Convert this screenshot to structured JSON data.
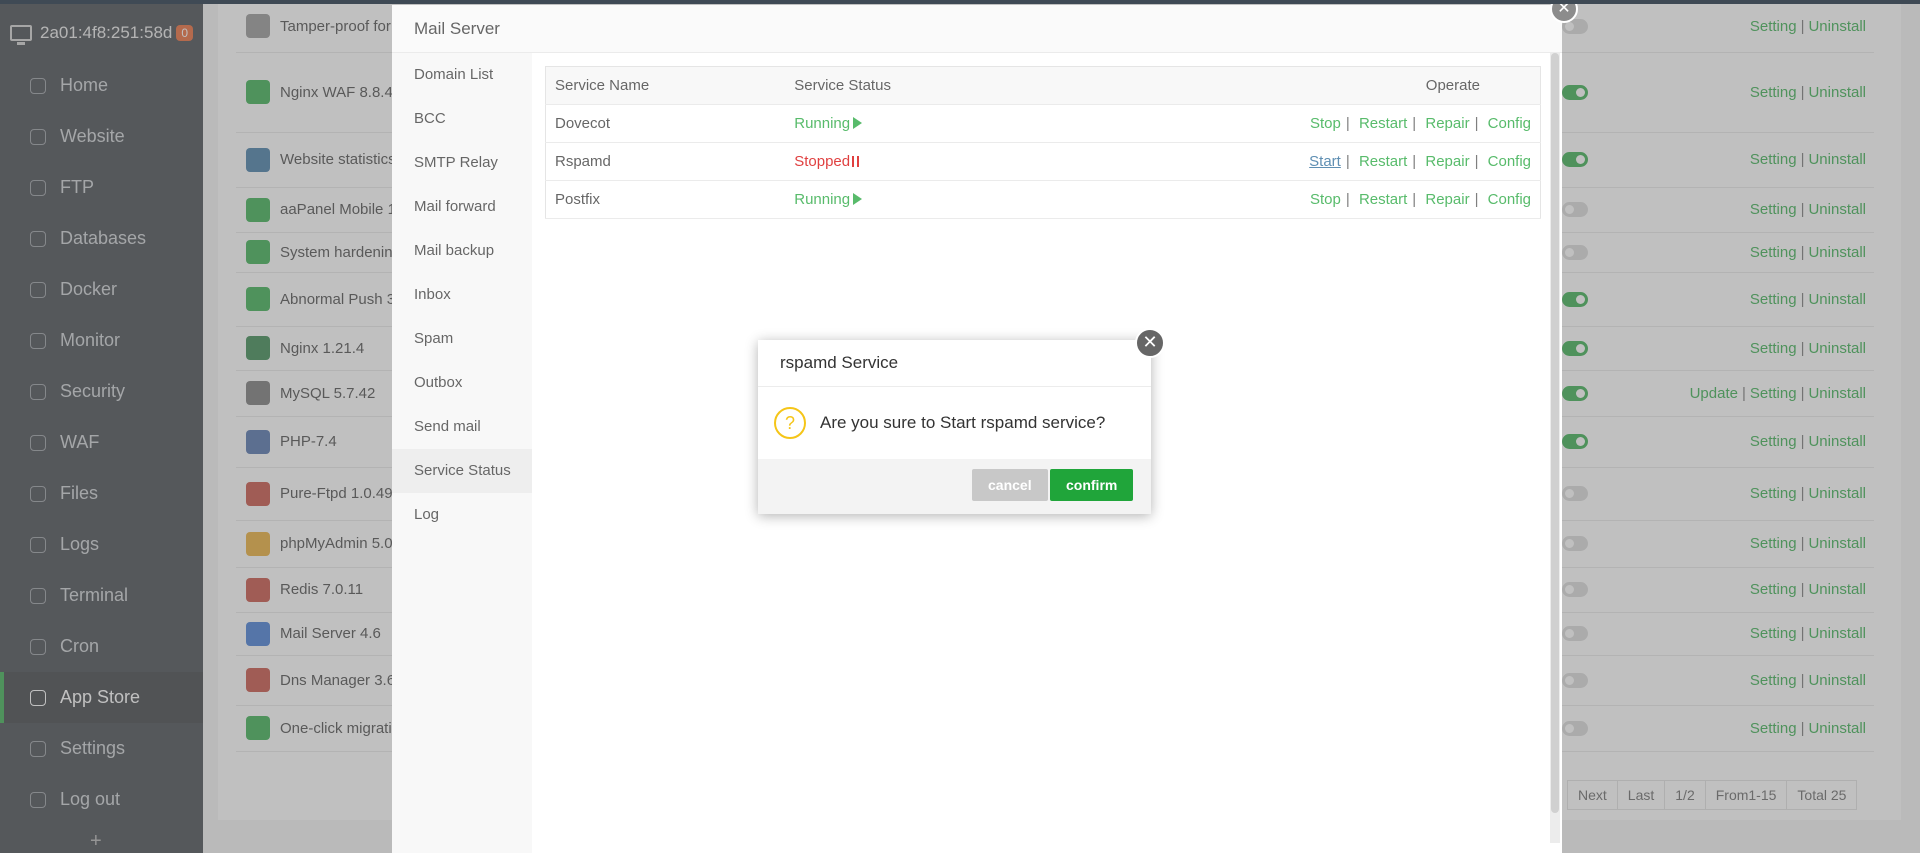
{
  "server": {
    "ip": "2a01:4f8:251:58d",
    "badge": "0"
  },
  "sidebar": {
    "items": [
      {
        "label": "Home"
      },
      {
        "label": "Website"
      },
      {
        "label": "FTP"
      },
      {
        "label": "Databases"
      },
      {
        "label": "Docker"
      },
      {
        "label": "Monitor"
      },
      {
        "label": "Security"
      },
      {
        "label": "WAF"
      },
      {
        "label": "Files"
      },
      {
        "label": "Logs"
      },
      {
        "label": "Terminal"
      },
      {
        "label": "Cron"
      },
      {
        "label": "App Store"
      },
      {
        "label": "Settings"
      },
      {
        "label": "Log out"
      }
    ],
    "add_label": "+"
  },
  "apps": [
    {
      "name": "Tamper-proof for",
      "on": false,
      "ops": [
        "Setting",
        "Uninstall"
      ]
    },
    {
      "name": "Nginx WAF 8.8.4",
      "on": true,
      "ops": [
        "Setting",
        "Uninstall"
      ]
    },
    {
      "name": "Website statistics",
      "on": true,
      "ops": [
        "Setting",
        "Uninstall"
      ]
    },
    {
      "name": "aaPanel Mobile 1",
      "on": false,
      "ops": [
        "Setting",
        "Uninstall"
      ]
    },
    {
      "name": "System hardening",
      "on": false,
      "ops": [
        "Setting",
        "Uninstall"
      ]
    },
    {
      "name": "Abnormal Push 3",
      "on": true,
      "ops": [
        "Setting",
        "Uninstall"
      ]
    },
    {
      "name": "Nginx 1.21.4",
      "on": true,
      "ops": [
        "Setting",
        "Uninstall"
      ]
    },
    {
      "name": "MySQL 5.7.42",
      "on": true,
      "ops": [
        "Update",
        "Setting",
        "Uninstall"
      ]
    },
    {
      "name": "PHP-7.4",
      "on": true,
      "ops": [
        "Setting",
        "Uninstall"
      ]
    },
    {
      "name": "Pure-Ftpd 1.0.49",
      "on": false,
      "ops": [
        "Setting",
        "Uninstall"
      ]
    },
    {
      "name": "phpMyAdmin 5.0",
      "on": false,
      "ops": [
        "Setting",
        "Uninstall"
      ]
    },
    {
      "name": "Redis 7.0.11",
      "on": false,
      "ops": [
        "Setting",
        "Uninstall"
      ]
    },
    {
      "name": "Mail Server 4.6",
      "on": false,
      "ops": [
        "Setting",
        "Uninstall"
      ]
    },
    {
      "name": "Dns Manager 3.6",
      "on": false,
      "ops": [
        "Setting",
        "Uninstall"
      ]
    },
    {
      "name": "One-click migrati",
      "on": false,
      "ops": [
        "Setting",
        "Uninstall"
      ]
    }
  ],
  "pager": {
    "next": "Next",
    "last": "Last",
    "page": "1/2",
    "range": "From1-15",
    "total": "Total 25"
  },
  "mail": {
    "title": "Mail Server",
    "menu": [
      "Domain List",
      "BCC",
      "SMTP Relay",
      "Mail forward",
      "Mail backup",
      "Inbox",
      "Spam",
      "Outbox",
      "Send mail",
      "Service Status",
      "Log"
    ],
    "selected_menu": "Service Status",
    "table": {
      "headers": {
        "name": "Service Name",
        "status": "Service Status",
        "operate": "Operate"
      },
      "rows": [
        {
          "name": "Dovecot",
          "status": "Running",
          "ops": [
            "Stop",
            "Restart",
            "Repair",
            "Config"
          ]
        },
        {
          "name": "Rspamd",
          "status": "Stopped",
          "ops": [
            "Start",
            "Restart",
            "Repair",
            "Config"
          ]
        },
        {
          "name": "Postfix",
          "status": "Running",
          "ops": [
            "Stop",
            "Restart",
            "Repair",
            "Config"
          ]
        }
      ]
    }
  },
  "dialog": {
    "title": "rspamd Service",
    "message": "Are you sure to Start rspamd service?",
    "cancel": "cancel",
    "confirm": "confirm"
  },
  "colors": {
    "accent": "#20a53a",
    "stopped": "#d60000",
    "sidebar": "#2c3138",
    "badge": "#e8541c"
  }
}
